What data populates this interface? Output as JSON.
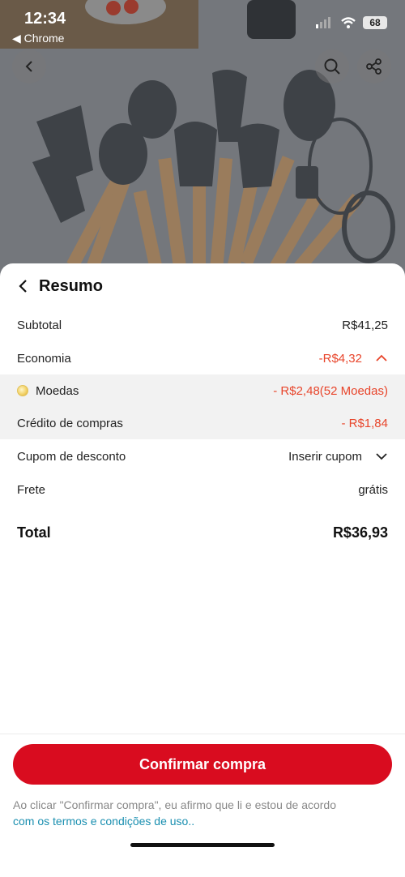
{
  "status_bar": {
    "time": "12:34",
    "back_app": "◀ Chrome",
    "battery": "68"
  },
  "sheet": {
    "title": "Resumo",
    "rows": {
      "subtotal": {
        "label": "Subtotal",
        "value": "R$41,25"
      },
      "economia": {
        "label": "Economia",
        "value": "-R$4,32"
      },
      "moedas": {
        "label": "Moedas",
        "value": "- R$2,48(52 Moedas)"
      },
      "credito": {
        "label": "Crédito de compras",
        "value": "- R$1,84"
      },
      "cupom": {
        "label": "Cupom de desconto",
        "value": "Inserir cupom"
      },
      "frete": {
        "label": "Frete",
        "value": "grátis"
      },
      "total": {
        "label": "Total",
        "value": "R$36,93"
      }
    },
    "confirm_label": "Confirmar compra",
    "disclaimer_text": "Ao clicar \"Confirmar compra\", eu afirmo que li e estou de acordo",
    "disclaimer_link": "com os termos e condições de uso.."
  },
  "colors": {
    "accent": "#d90c1f",
    "discount": "#e8452b",
    "link": "#1a8fb0"
  },
  "icons": [
    "back-icon",
    "search-icon",
    "share-icon",
    "chevron-left-icon",
    "chevron-up-icon",
    "chevron-down-icon",
    "coin-icon"
  ]
}
